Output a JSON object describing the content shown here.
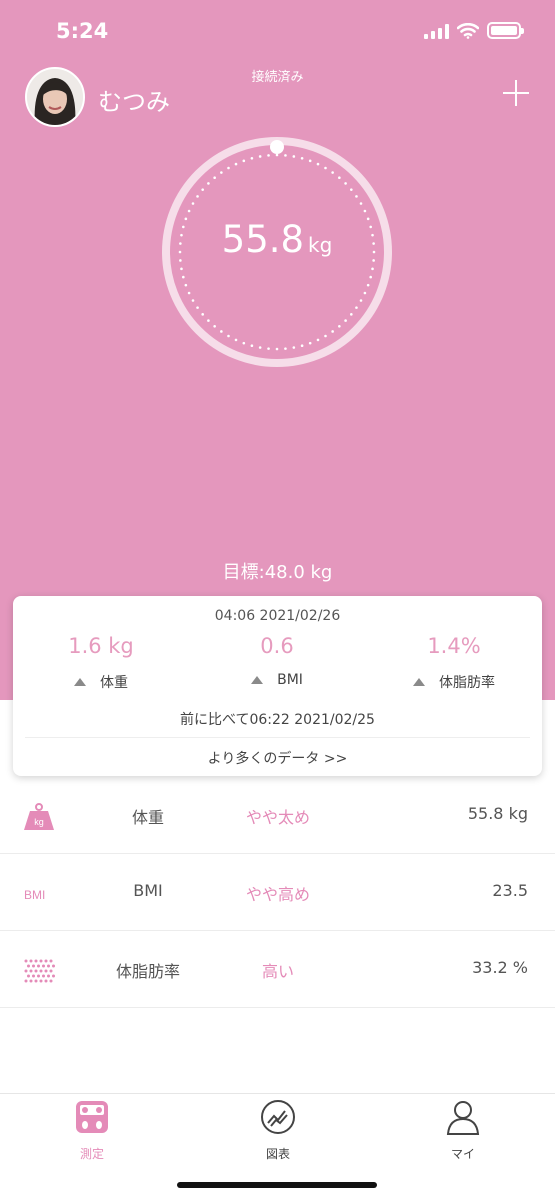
{
  "status_bar": {
    "time": "5:24"
  },
  "header": {
    "connection_status": "接続済み",
    "username": "むつみ",
    "icons": {
      "add": "plus-icon",
      "avatar": "user-photo"
    }
  },
  "gauge": {
    "value": "55.8",
    "unit": "kg"
  },
  "target": {
    "text": "目標:48.0 kg"
  },
  "summary_card": {
    "timestamp": "04:06 2021/02/26",
    "stats": [
      {
        "value": "1.6 kg",
        "label": "体重",
        "trend": "up"
      },
      {
        "value": "0.6",
        "label": "BMI",
        "trend": "up"
      },
      {
        "value": "1.4%",
        "label": "体脂肪率",
        "trend": "up"
      }
    ],
    "compare_text": "前に比べて06:22 2021/02/25",
    "more_link": "より多くのデータ >>"
  },
  "metrics": [
    {
      "icon": "weight-kg-icon",
      "icon_text": "kg",
      "name": "体重",
      "status": "やや太め",
      "value": "55.8 kg"
    },
    {
      "icon": "bmi-icon",
      "icon_text": "BMI",
      "name": "BMI",
      "status": "やや高め",
      "value": "23.5"
    },
    {
      "icon": "body-fat-dots-icon",
      "name": "体脂肪率",
      "status": "高い",
      "value": "33.2 %"
    }
  ],
  "tabs": [
    {
      "label": "測定",
      "icon": "scale-icon",
      "active": true
    },
    {
      "label": "図表",
      "icon": "chart-icon",
      "active": false
    },
    {
      "label": "マイ",
      "icon": "person-icon",
      "active": false
    }
  ],
  "colors": {
    "primary": "#e497bd",
    "accent": "#e48bb8",
    "stat_value": "#e69bbe"
  }
}
